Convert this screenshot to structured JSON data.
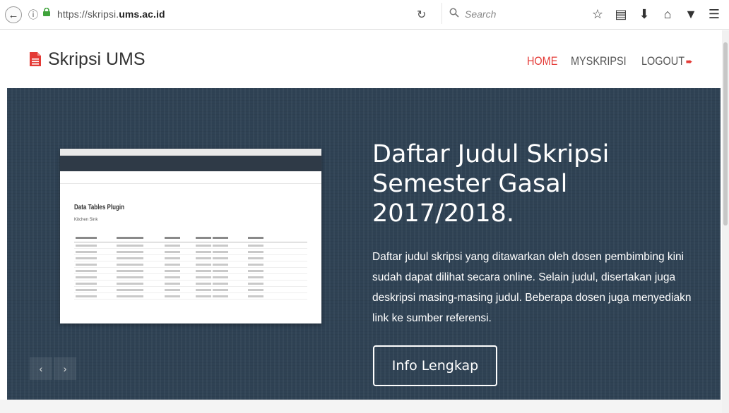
{
  "browser": {
    "url_prefix": "https://skripsi.",
    "url_domain": "ums.ac.id",
    "search_placeholder": "Search"
  },
  "site": {
    "brand": "Skripsi UMS",
    "nav": [
      {
        "label": "HOME",
        "active": true
      },
      {
        "label": "MYSKRIPSI",
        "active": false
      },
      {
        "label": "LOGOUT",
        "active": false
      }
    ]
  },
  "hero": {
    "title": "Daftar Judul Skripsi Semester Gasal 2017/2018.",
    "description": "Daftar judul skripsi yang ditawarkan oleh dosen pembimbing kini sudah dapat dilihat secara online. Selain judul, disertakan juga deskripsi masing-masing judul. Beberapa dosen juga menyediakn link ke sumber referensi.",
    "button_label": "Info Lengkap",
    "screenshot": {
      "title": "Data Tables Plugin",
      "subtitle": "Kitchen Sink"
    }
  },
  "colors": {
    "accent": "#e43a36",
    "hero_bg": "#2f4254"
  }
}
